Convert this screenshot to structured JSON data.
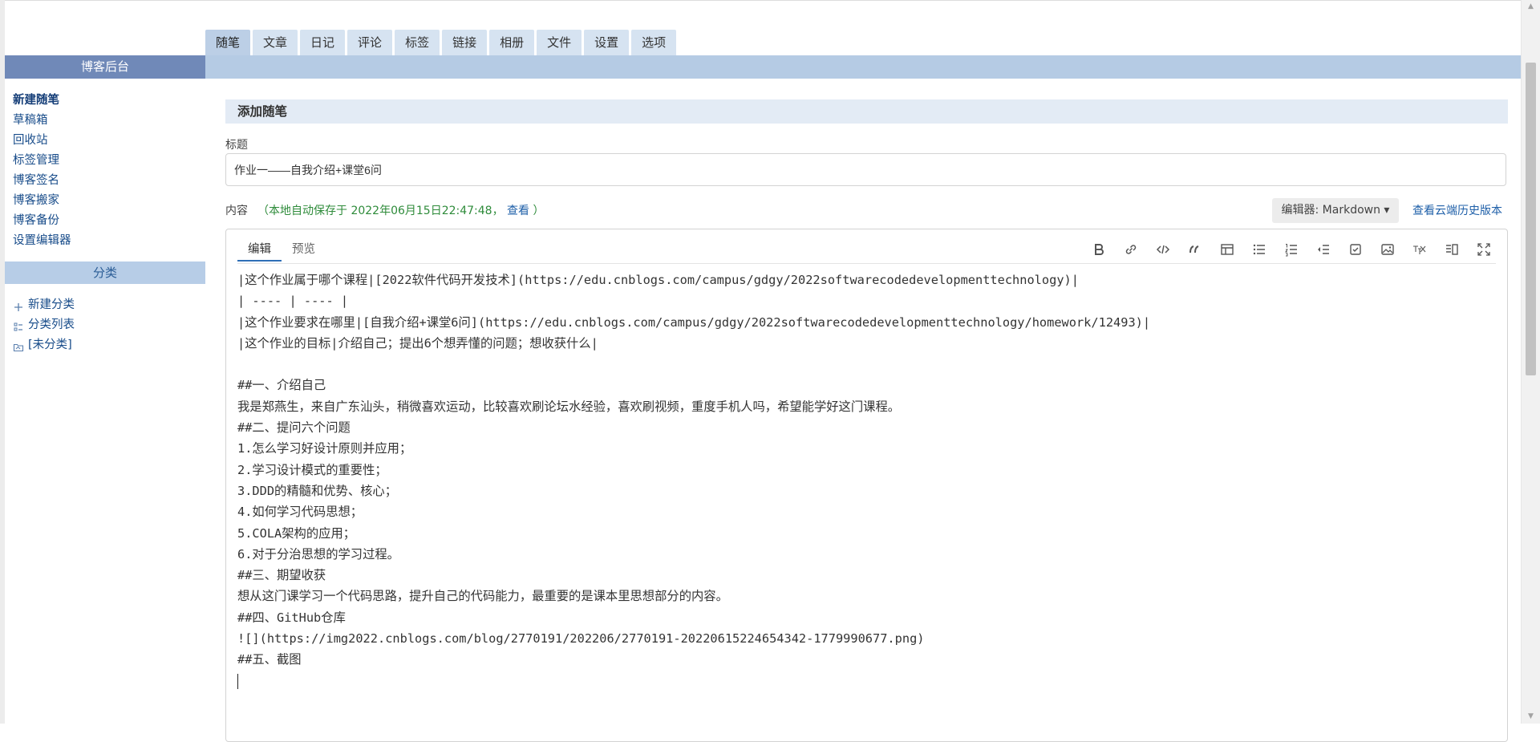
{
  "tabs": [
    "随笔",
    "文章",
    "日记",
    "评论",
    "标签",
    "链接",
    "相册",
    "文件",
    "设置",
    "选项"
  ],
  "sidebar": {
    "title": "博客后台",
    "links": [
      "新建随笔",
      "草稿箱",
      "回收站",
      "标签管理",
      "博客签名",
      "博客搬家",
      "博客备份",
      "设置编辑器"
    ],
    "category_title": "分类",
    "category_links": [
      "新建分类",
      "分类列表",
      "[未分类]"
    ]
  },
  "main": {
    "section_title": "添加随笔",
    "title_label": "标题",
    "title_value": "作业一——自我介绍+课堂6问",
    "content_label": "内容",
    "autosave_text": "（本地自动保存于 2022年06月15日22:47:48，",
    "autosave_view": "查看",
    "autosave_close": "）",
    "editor_select": "编辑器: Markdown ▾",
    "history_link": "查看云端历史版本"
  },
  "editor": {
    "tabs": [
      "编辑",
      "预览"
    ],
    "toolbar": [
      "bold-icon",
      "link-icon",
      "code-icon",
      "quote-icon",
      "table-icon",
      "unordered-list-icon",
      "ordered-list-icon",
      "outdent-icon",
      "task-list-icon",
      "image-icon",
      "tex-icon",
      "split-view-icon",
      "fullscreen-icon"
    ],
    "lines": [
      "|这个作业属于哪个课程|[2022软件代码开发技术](https://edu.cnblogs.com/campus/gdgy/2022softwarecodedevelopmenttechnology)|",
      "| ---- | ---- |",
      "|这个作业要求在哪里|[自我介绍+课堂6问](https://edu.cnblogs.com/campus/gdgy/2022softwarecodedevelopmenttechnology/homework/12493)|",
      "|这个作业的目标|介绍自己；提出6个想弄懂的问题；想收获什么|",
      "",
      "##一、介绍自己",
      "我是郑燕生，来自广东汕头，稍微喜欢运动，比较喜欢刷论坛水经验，喜欢刷视频，重度手机人吗，希望能学好这门课程。",
      "##二、提问六个问题",
      "1.怎么学习好设计原则并应用；",
      "2.学习设计模式的重要性；",
      "3.DDD的精髓和优势、核心；",
      "4.如何学习代码思想；",
      "5.COLA架构的应用；",
      "6.对于分治思想的学习过程。",
      "##三、期望收获",
      "想从这门课学习一个代码思路，提升自己的代码能力，最重要的是课本里思想部分的内容。",
      "##四、GitHub仓库",
      "![](https://img2022.cnblogs.com/blog/2770191/202206/2770191-20220615224654342-1779990677.png)",
      "##五、截图"
    ]
  }
}
